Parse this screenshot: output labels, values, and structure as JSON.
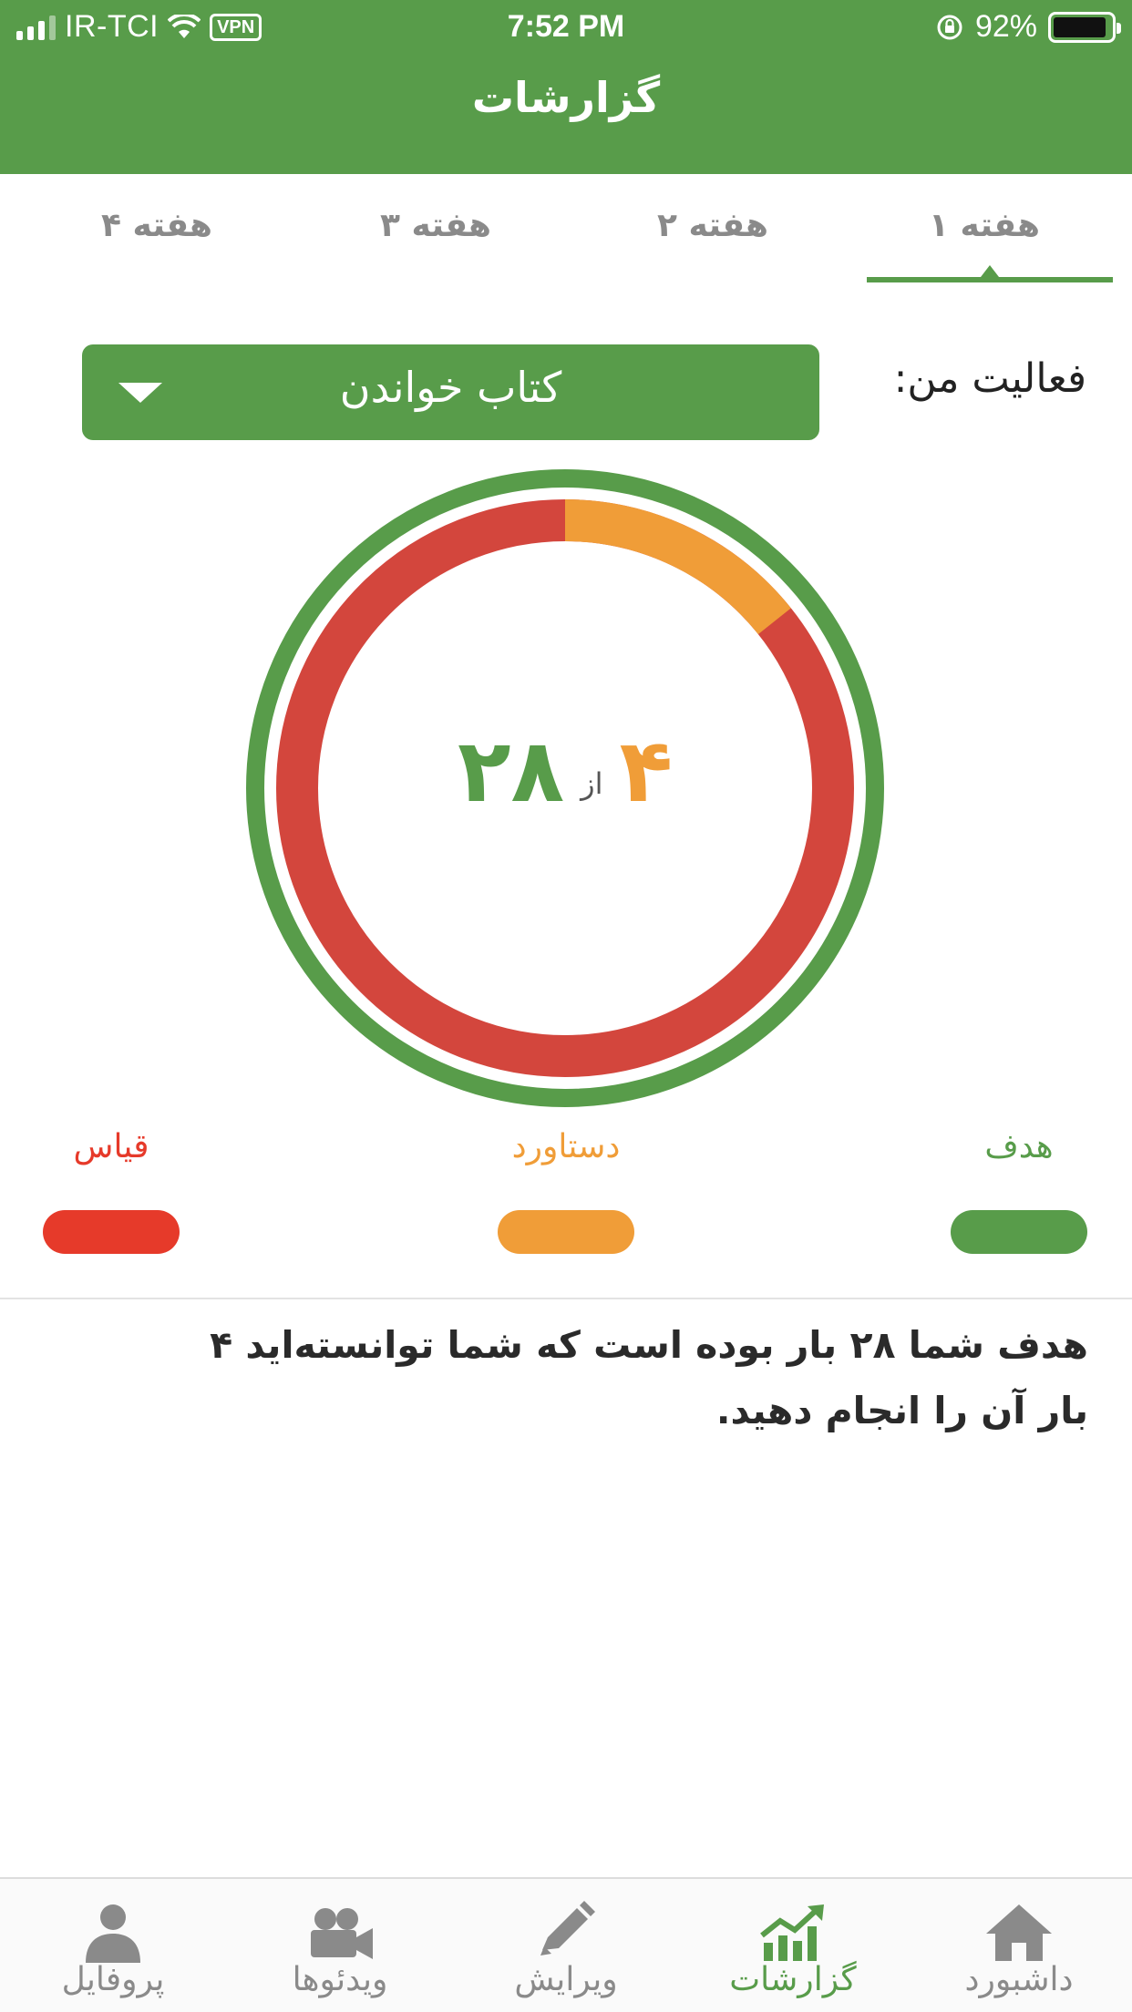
{
  "status_bar": {
    "carrier": "IR-TCI",
    "vpn": "VPN",
    "time": "7:52 PM",
    "battery": "92%",
    "battery_level": 0.92
  },
  "header": {
    "title": "گزارشات"
  },
  "tabs": [
    {
      "label": "هفته ۱",
      "active": true
    },
    {
      "label": "هفته ۲",
      "active": false
    },
    {
      "label": "هفته ۳",
      "active": false
    },
    {
      "label": "هفته ۴",
      "active": false
    }
  ],
  "activity": {
    "label": "فعالیت من:",
    "selected": "کتاب خواندن"
  },
  "progress": {
    "achieved_display": "۴",
    "of_label": "از",
    "goal_display": "۲۸",
    "achieved": 4,
    "goal": 28
  },
  "legend": [
    {
      "label": "هدف",
      "color": "#589c4a"
    },
    {
      "label": "دستاورد",
      "color": "#f09d38"
    },
    {
      "label": "قیاس",
      "color": "#e63a2a"
    }
  ],
  "colors": {
    "primary": "#589c4a",
    "achieved": "#f09d38",
    "remaining": "#d3463d",
    "inactive": "#8a8a8a"
  },
  "summary": "هدف شما ۲۸ بار بوده است که شما توانسته‌اید ۴ بار آن را انجام دهید.",
  "bottom_nav": [
    {
      "label": "داشبورد",
      "icon": "home-icon",
      "active": false
    },
    {
      "label": "گزارشات",
      "icon": "chart-icon",
      "active": true
    },
    {
      "label": "ویرایش",
      "icon": "pencil-icon",
      "active": false
    },
    {
      "label": "ویدئوها",
      "icon": "video-camera-icon",
      "active": false
    },
    {
      "label": "پروفایل",
      "icon": "user-icon",
      "active": false
    }
  ]
}
